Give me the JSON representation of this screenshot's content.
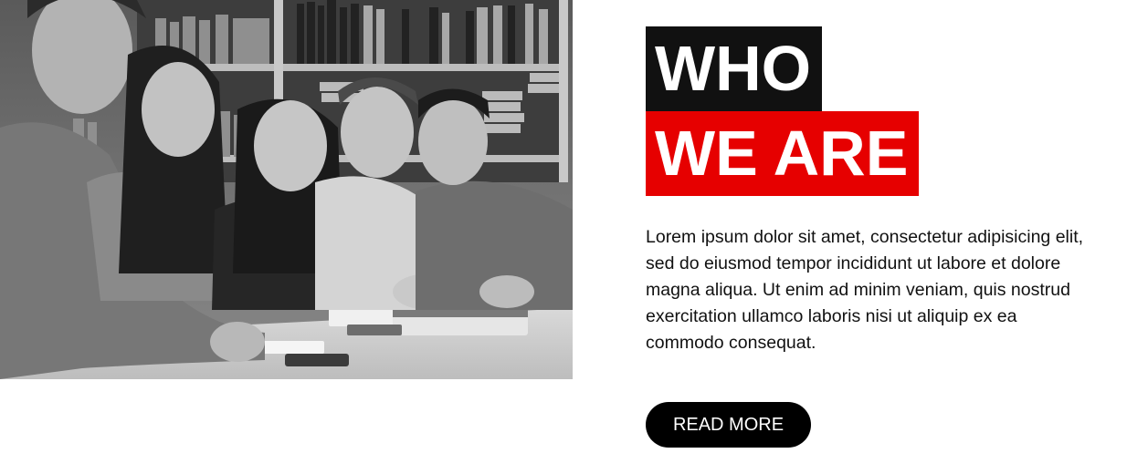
{
  "photo": {
    "alt": "Five smiling students sitting at a library table"
  },
  "heading": {
    "line1": "WHO",
    "line2": "WE ARE"
  },
  "body": {
    "text": "Lorem ipsum dolor sit amet, consectetur adipisicing elit, sed do eiusmod tempor incididunt ut labore et dolore magna aliqua. Ut enim ad minim veniam, quis nostrud exercitation ullamco laboris nisi ut aliquip ex ea commodo consequat."
  },
  "cta": {
    "label": "READ MORE"
  },
  "colors": {
    "heading_dark_bg": "#111111",
    "heading_accent_bg": "#e60000",
    "button_bg": "#000000",
    "text": "#111111"
  }
}
